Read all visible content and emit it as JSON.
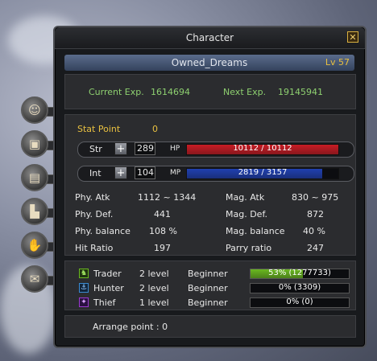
{
  "window": {
    "title": "Character",
    "close_icon": "✕"
  },
  "character": {
    "name": "Owned_Dreams",
    "level": "Lv 57"
  },
  "exp": {
    "current_label": "Current Exp.",
    "current_value": "1614694",
    "next_label": "Next Exp.",
    "next_value": "19145941"
  },
  "stat_point": {
    "label": "Stat Point",
    "value": "0"
  },
  "str": {
    "label": "Str",
    "value": "289",
    "bar_label": "HP",
    "bar_text": "10112 / 10112",
    "fill": 1.0,
    "color": "#c81c24"
  },
  "int": {
    "label": "Int",
    "value": "104",
    "bar_label": "MP",
    "bar_text": "2819 / 3157",
    "fill": 0.893,
    "color": "#2040b0"
  },
  "attributes": {
    "phy_atk": {
      "label": "Phy. Atk",
      "value": "1112 ~ 1344"
    },
    "mag_atk": {
      "label": "Mag. Atk",
      "value": "830 ~ 975"
    },
    "phy_def": {
      "label": "Phy. Def.",
      "value": "441"
    },
    "mag_def": {
      "label": "Mag. Def.",
      "value": "872"
    },
    "phy_bal": {
      "label": "Phy. balance",
      "value": "108 %"
    },
    "mag_bal": {
      "label": "Mag. balance",
      "value": "40 %"
    },
    "hit": {
      "label": "Hit Ratio",
      "value": "197"
    },
    "parry": {
      "label": "Parry ratio",
      "value": "247"
    }
  },
  "jobs": [
    {
      "name": "Trader",
      "level": "2 level",
      "rank": "Beginner",
      "progress_text": "53% (1277733)",
      "fill": 0.53,
      "icon": "trader-icon",
      "color": "#6ab820"
    },
    {
      "name": "Hunter",
      "level": "2 level",
      "rank": "Beginner",
      "progress_text": "0% (3309)",
      "fill": 0,
      "icon": "hunter-icon",
      "color": "#3a8ad0"
    },
    {
      "name": "Thief",
      "level": "1 level",
      "rank": "Beginner",
      "progress_text": "0% (0)",
      "fill": 0,
      "icon": "thief-icon",
      "color": "#9a3ad0"
    }
  ],
  "arrange": {
    "label": "Arrange point : 0"
  },
  "tabs": [
    "character-tab-icon",
    "inventory-tab-icon",
    "skill-book-tab-icon",
    "boots-tab-icon",
    "handshake-tab-icon",
    "scroll-tab-icon"
  ]
}
